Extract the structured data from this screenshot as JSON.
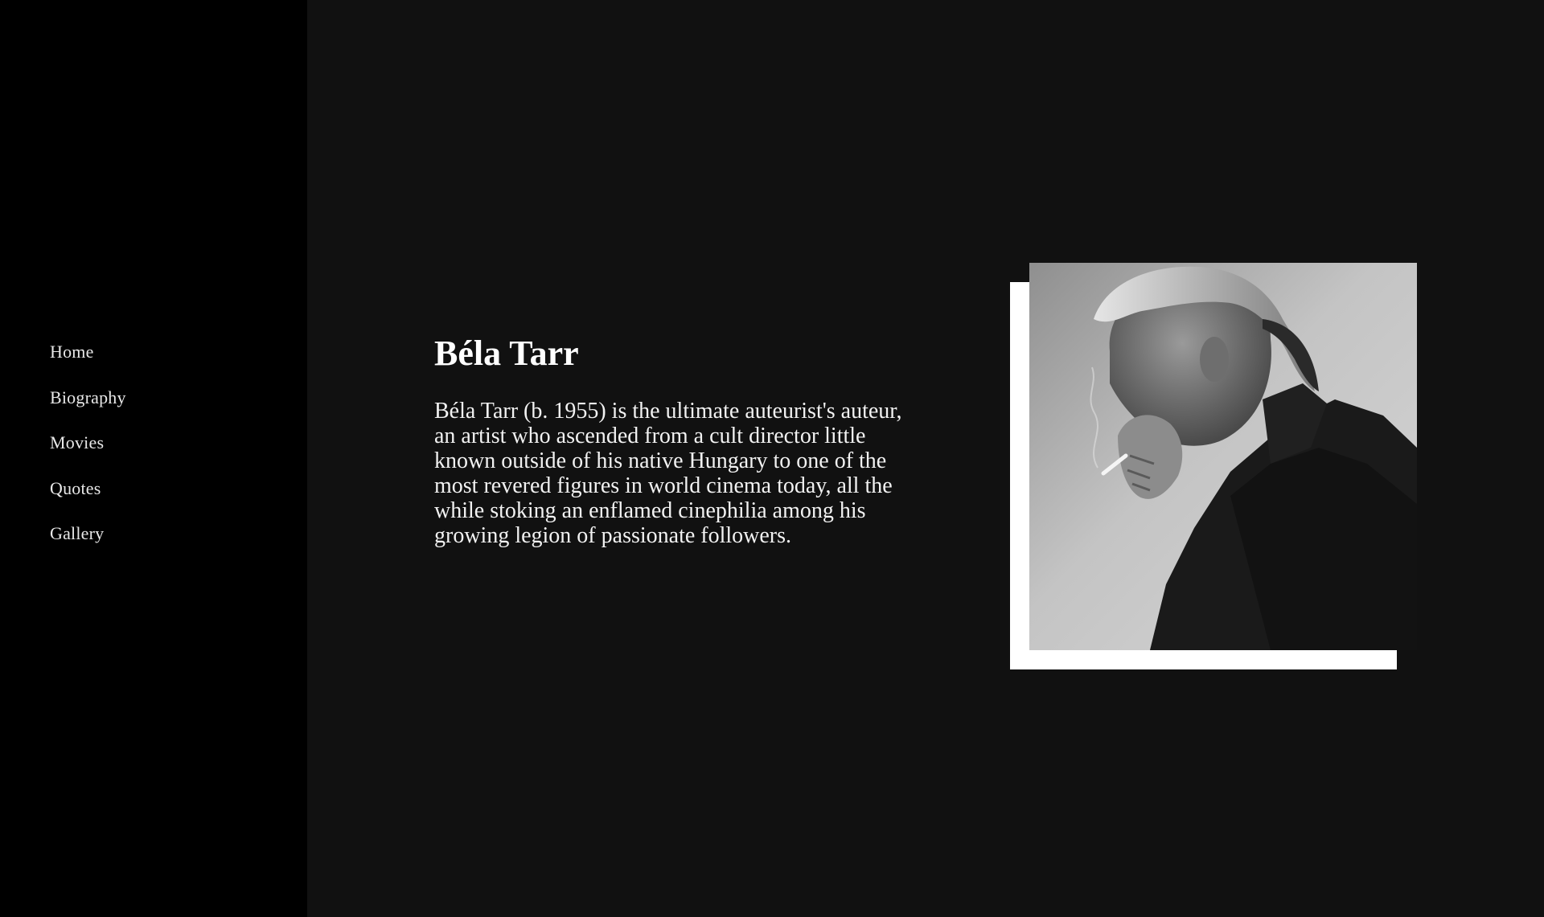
{
  "sidebar": {
    "items": [
      {
        "label": "Home"
      },
      {
        "label": "Biography"
      },
      {
        "label": "Movies"
      },
      {
        "label": "Quotes"
      },
      {
        "label": "Gallery"
      }
    ]
  },
  "main": {
    "title": "Béla Tarr",
    "bio": "Béla Tarr (b. 1955) is the ultimate auteurist's auteur, an artist who ascended from a cult director little known outside of his native Hungary to one of the most revered figures in world cinema today, all the while stoking an enflamed cinephilia among his growing legion of passionate followers."
  },
  "colors": {
    "page_background": "#111111",
    "sidebar_background": "#000000",
    "text": "#f2f2f2",
    "frame": "#ffffff"
  }
}
